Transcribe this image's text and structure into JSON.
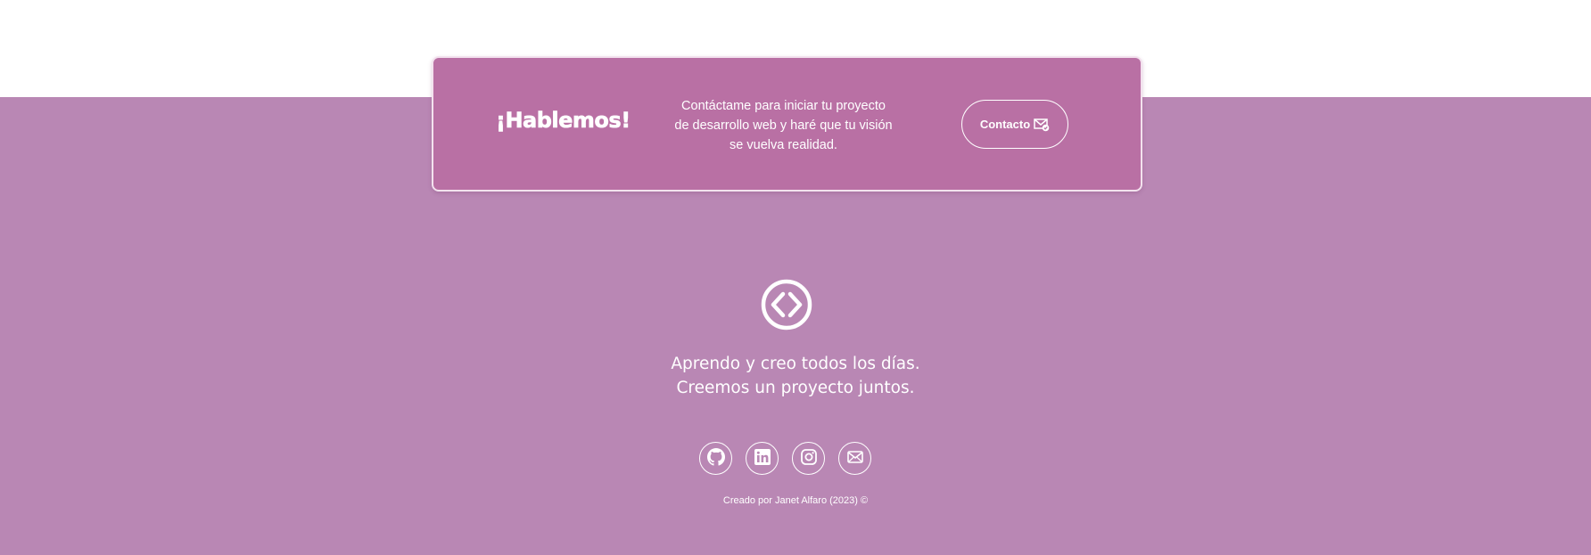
{
  "cta": {
    "title": "¡Hablemos!",
    "text": "Contáctame para iniciar tu proyecto de desarrollo web y haré que tu visión se vuelva realidad.",
    "button_label": "Contacto",
    "button_icon": "mail-check-icon"
  },
  "footer": {
    "logo_icon": "code-brackets-circle-icon",
    "tagline_line1": "Aprendo y creo todos los días.",
    "tagline_line2": "Creemos un proyecto juntos.",
    "socials": [
      {
        "icon": "github-icon"
      },
      {
        "icon": "linkedin-icon"
      },
      {
        "icon": "instagram-icon"
      },
      {
        "icon": "email-icon"
      }
    ],
    "credit": "Creado por Janet Alfaro (2023) ©"
  },
  "colors": {
    "page_background": "#ffffff",
    "footer_background": "#b987b4",
    "card_background": "#b970a4",
    "text": "#ffffff"
  }
}
